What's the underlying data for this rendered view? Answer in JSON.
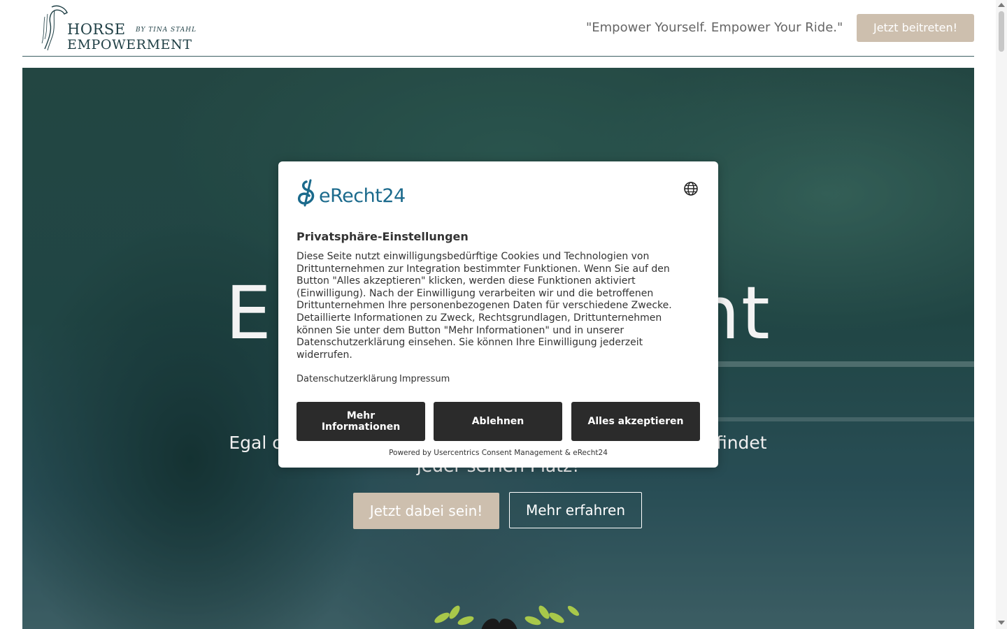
{
  "header": {
    "logo": {
      "line1": "HORSE",
      "byline": "BY TINA STAHL",
      "line2": "EMPOWERMENT"
    },
    "slogan": "\"Empower Yourself. Empower Your Ride.\"",
    "join_button": "Jetzt beitreten!"
  },
  "hero": {
    "title": "Empowerment",
    "subtitle": "Egal ob Anfänger oder fortgeschrittener Reiter, bei uns findet jeder seinen Platz!",
    "primary_button": "Jetzt dabei sein!",
    "secondary_button": "Mehr erfahren"
  },
  "consent": {
    "brand": "eRecht24",
    "title": "Privatsphäre-Einstellungen",
    "body": "Diese Seite nutzt einwilligungsbedürftige Cookies und Technologien von Drittunternehmen zur Integration bestimmter Funktionen. Wenn Sie auf den Button \"Alles akzeptieren\" klicken, werden diese Funktionen aktiviert (Einwilligung). Nach der Einwilligung verarbeiten wir und die betroffenen Drittunternehmen Ihre personenbezogenen Daten für verschiedene Zwecke. Detaillierte Informationen zu Zweck, Rechtsgrundlagen, Drittunternehmen können Sie unter dem Button \"Mehr Informationen\" und in unserer Datenschutzerklärung einsehen. Sie können Ihre Einwilligung jederzeit widerrufen.",
    "links": {
      "privacy": "Datenschutzerklärung",
      "imprint": "Impressum"
    },
    "buttons": {
      "more_info": "Mehr Informationen",
      "deny": "Ablehnen",
      "accept": "Alles akzeptieren"
    },
    "powered_by": "Powered by Usercentrics Consent Management & eRecht24"
  },
  "colors": {
    "accent_beige": "#cdbfae",
    "brand_teal": "#1b6a8c",
    "dark_button": "#2b2b2b",
    "header_line": "#3d5f63"
  },
  "icons": {
    "language": "globe-icon",
    "logo_mark": "horse-head-icon",
    "decoration": "laurel-icon"
  }
}
